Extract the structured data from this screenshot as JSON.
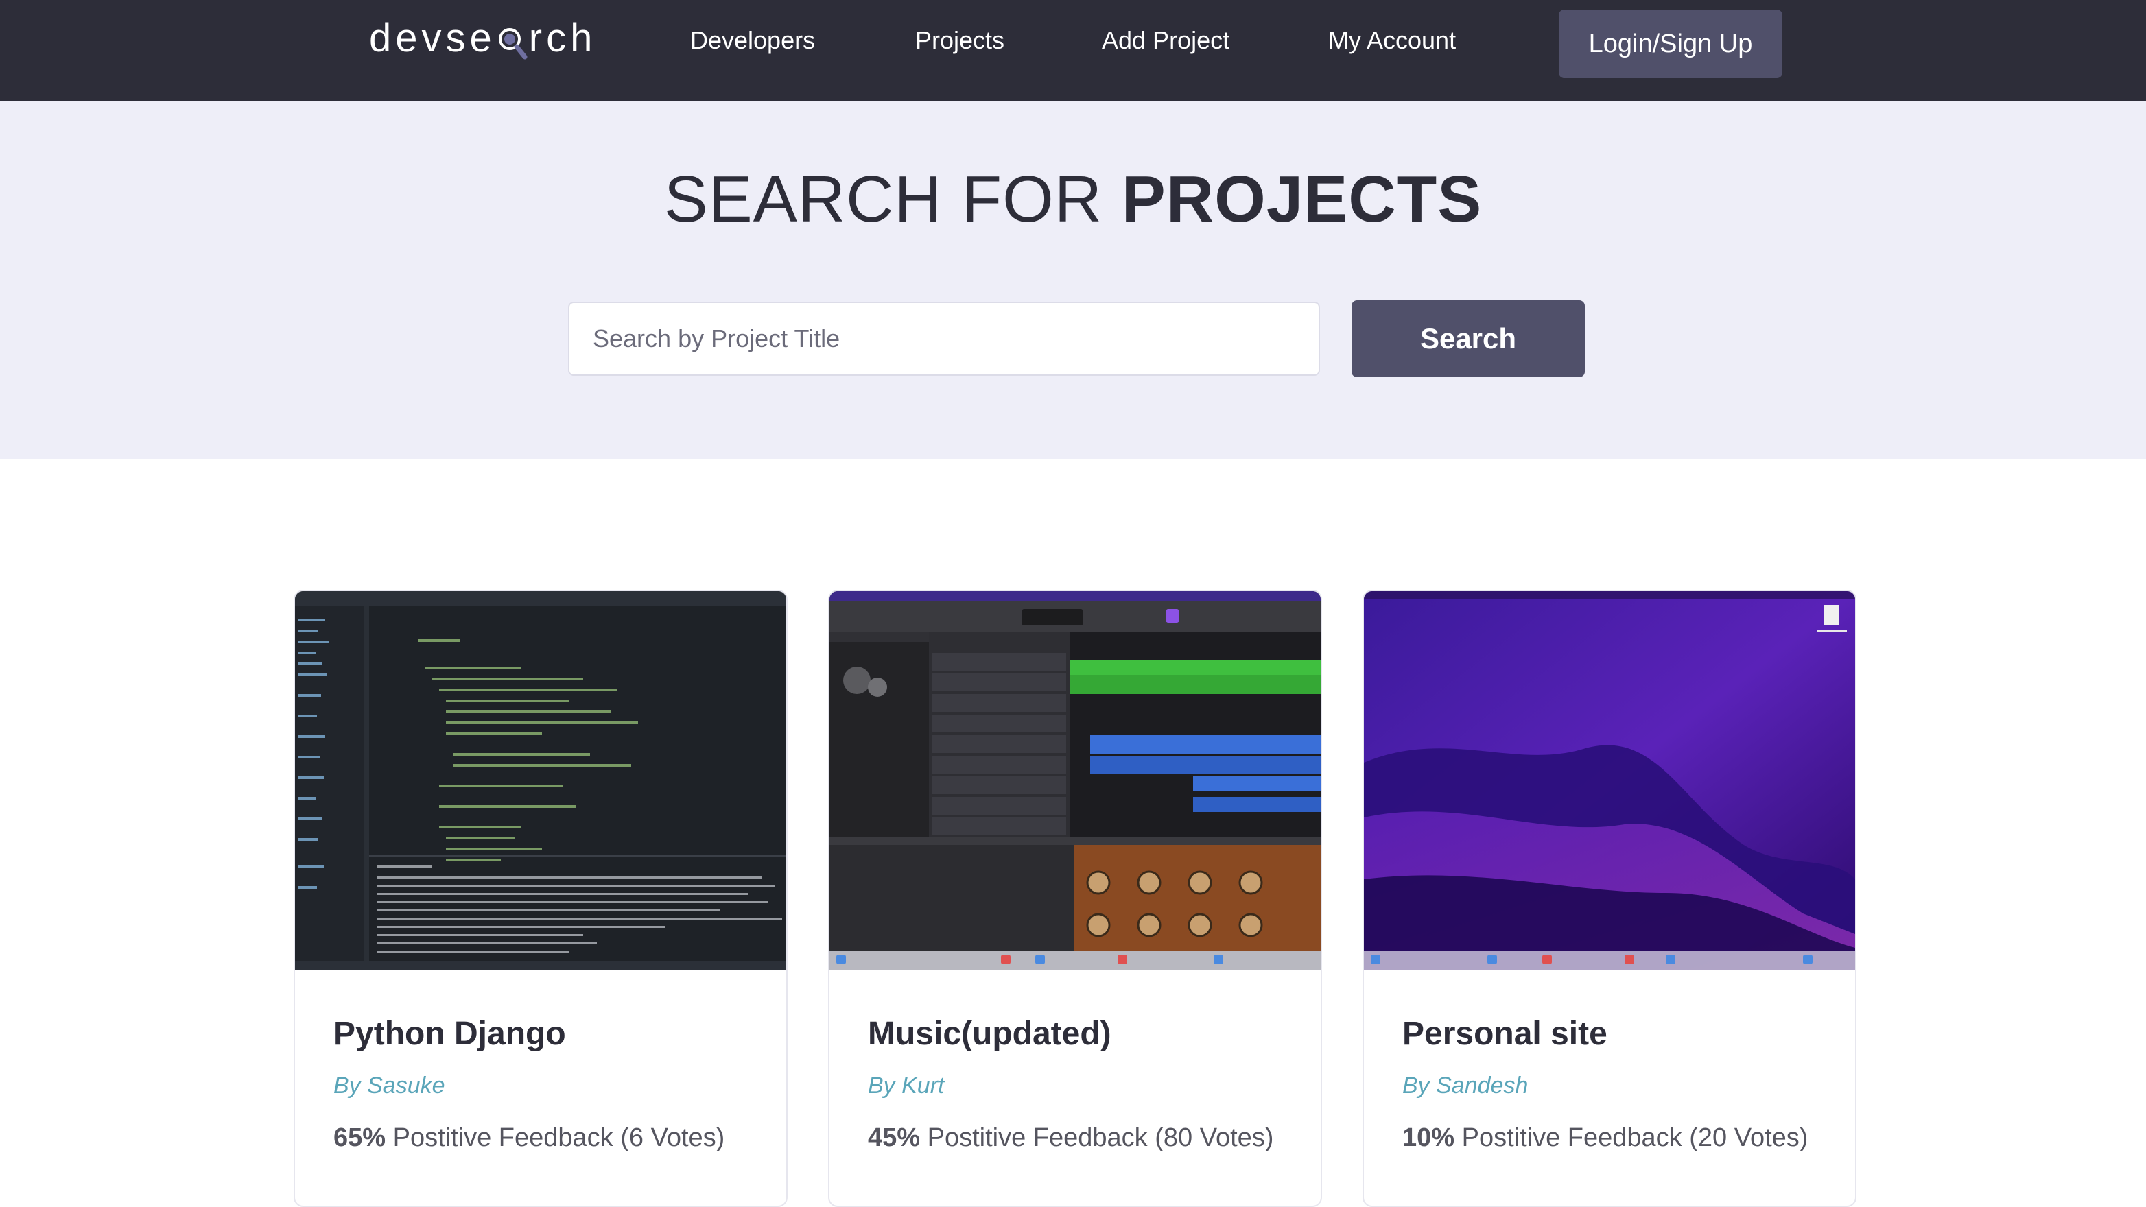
{
  "navbar": {
    "logo": "devsearch",
    "links": [
      "Developers",
      "Projects",
      "Add Project",
      "My Account"
    ],
    "login_label": "Login/Sign Up"
  },
  "hero": {
    "title_light": "SEARCH FOR ",
    "title_bold": "PROJECTS",
    "search_placeholder": "Search by Project Title",
    "search_button": "Search"
  },
  "projects": [
    {
      "title": "Python Django",
      "author": "By Sasuke",
      "percent": "65%",
      "feedback_text": " Postitive Feedback (6 Votes)",
      "thumbnail": "code-editor-screenshot"
    },
    {
      "title": "Music(updated)",
      "author": "By Kurt",
      "percent": "45%",
      "feedback_text": " Postitive Feedback (80 Votes)",
      "thumbnail": "daw-screenshot"
    },
    {
      "title": "Personal site",
      "author": "By Sandesh",
      "percent": "10%",
      "feedback_text": " Postitive Feedback (20 Votes)",
      "thumbnail": "desktop-wallpaper-screenshot"
    }
  ],
  "colors": {
    "nav_bg": "#2d2d39",
    "hero_bg": "#eeeef8",
    "button_bg": "#50506a",
    "author_color": "#5aa5b9"
  }
}
